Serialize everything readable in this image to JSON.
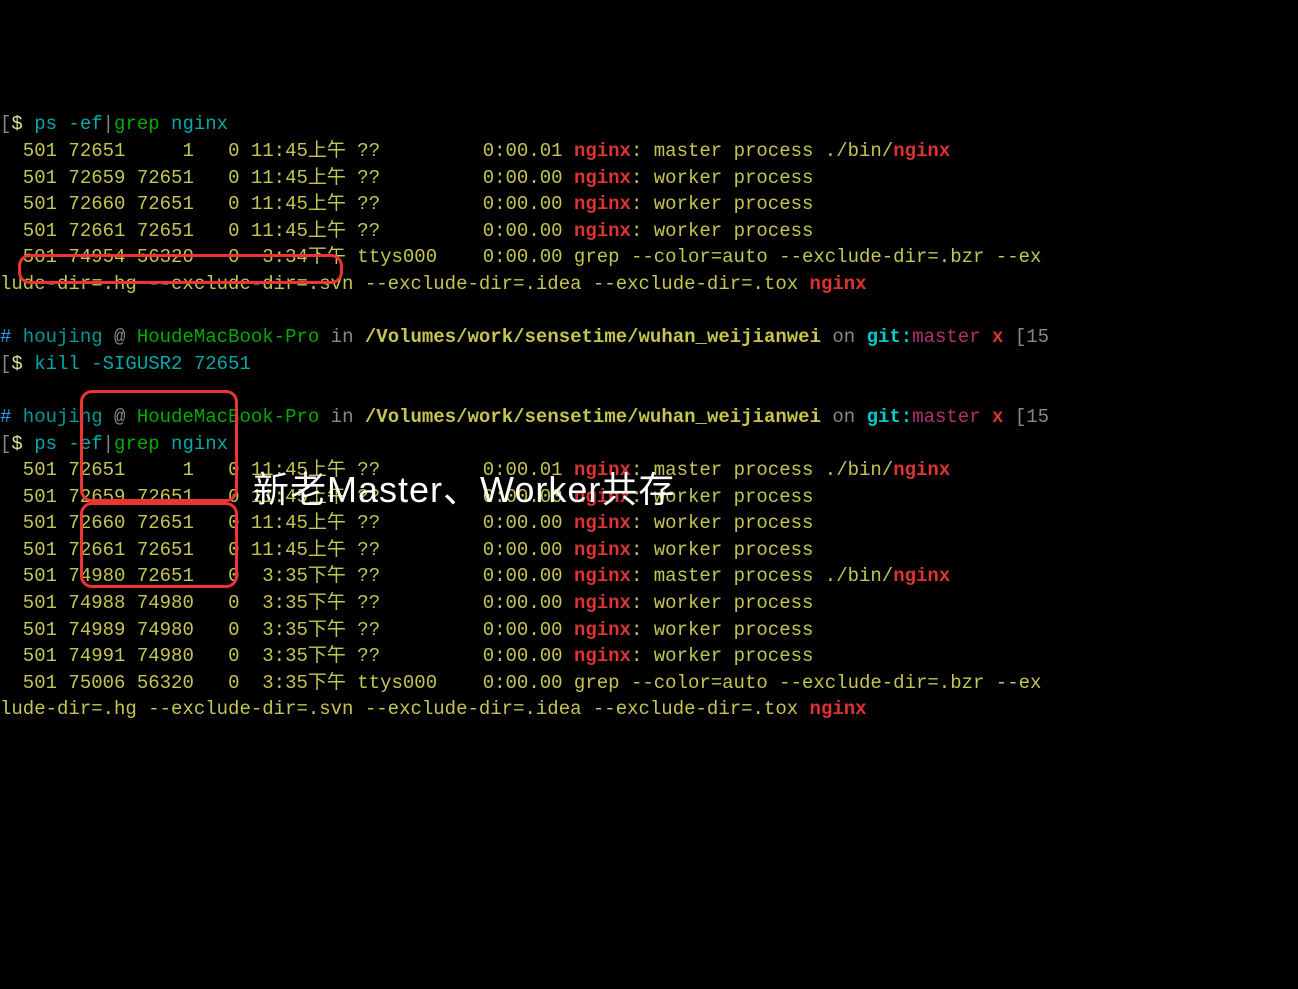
{
  "colors": {
    "bg": "#000000",
    "highlight": "#ee3333",
    "white": "#ffffff"
  },
  "overlay_text": "新老Master、Worker共存",
  "block1": {
    "prompt": {
      "bracket": "[",
      "dollar": "$",
      "cmd": " ps -ef",
      "pipe": "|",
      "grep": "grep",
      "arg": " nginx"
    },
    "rows": [
      {
        "uid": "  501",
        "pid": " 72651",
        "ppid": "     1",
        "c": "   0",
        "time": " 11:45上午",
        "tty": " ??",
        "elapsed": "         0:00.01 ",
        "proc": "nginx",
        "rest1": ": master process ./bin/",
        "rest2": "nginx"
      },
      {
        "uid": "  501",
        "pid": " 72659",
        "ppid": " 72651",
        "c": "   0",
        "time": " 11:45上午",
        "tty": " ??",
        "elapsed": "         0:00.00 ",
        "proc": "nginx",
        "rest1": ": worker process",
        "rest2": ""
      },
      {
        "uid": "  501",
        "pid": " 72660",
        "ppid": " 72651",
        "c": "   0",
        "time": " 11:45上午",
        "tty": " ??",
        "elapsed": "         0:00.00 ",
        "proc": "nginx",
        "rest1": ": worker process",
        "rest2": ""
      },
      {
        "uid": "  501",
        "pid": " 72661",
        "ppid": " 72651",
        "c": "   0",
        "time": " 11:45上午",
        "tty": " ??",
        "elapsed": "         0:00.00 ",
        "proc": "nginx",
        "rest1": ": worker process",
        "rest2": ""
      }
    ],
    "greprow": {
      "uid": "  501",
      "pid": " 74954",
      "ppid": " 56320",
      "c": "   0",
      "time": "  3:34下午",
      "tty": " ttys000",
      "elapsed": "    0:00.00 grep --color=auto --exclude-dir=.bzr --ex",
      "wrap": "lude-dir=.hg --exclude-dir=.svn --exclude-dir=.idea --exclude-dir=.tox ",
      "arg": "nginx"
    }
  },
  "ps1_1": {
    "hash": "#",
    "user": " houjing",
    "at": " @ ",
    "host": "HoudeMacBook-Pro",
    "in": " in ",
    "path": "/Volumes/work/sensetime/wuhan_weijianwei",
    "on": " on ",
    "git": "git:",
    "branch": "master",
    "x": " x",
    "time": " [15"
  },
  "kill": {
    "bracket": "[",
    "dollar": "$",
    "cmd": " kill -SIGUSR2 72651"
  },
  "ps1_2": {
    "hash": "#",
    "user": " houjing",
    "at": " @ ",
    "host": "HoudeMacBook-Pro",
    "in": " in ",
    "path": "/Volumes/work/sensetime/wuhan_weijianwei",
    "on": " on ",
    "git": "git:",
    "branch": "master",
    "x": " x",
    "time": " [15"
  },
  "block2": {
    "prompt": {
      "bracket": "[",
      "dollar": "$",
      "cmd": " ps -ef",
      "pipe": "|",
      "grep": "grep",
      "arg": " nginx"
    },
    "rows": [
      {
        "uid": "  501",
        "pid": " 72651",
        "ppid": "     1",
        "c": "   0",
        "time": " 11:45上午",
        "tty": " ??",
        "elapsed": "         0:00.01 ",
        "proc": "nginx",
        "rest1": ": master process ./bin/",
        "rest2": "nginx"
      },
      {
        "uid": "  501",
        "pid": " 72659",
        "ppid": " 72651",
        "c": "   0",
        "time": " 11:45上午",
        "tty": " ??",
        "elapsed": "         0:00.00 ",
        "proc": "nginx",
        "rest1": ": worker process",
        "rest2": ""
      },
      {
        "uid": "  501",
        "pid": " 72660",
        "ppid": " 72651",
        "c": "   0",
        "time": " 11:45上午",
        "tty": " ??",
        "elapsed": "         0:00.00 ",
        "proc": "nginx",
        "rest1": ": worker process",
        "rest2": ""
      },
      {
        "uid": "  501",
        "pid": " 72661",
        "ppid": " 72651",
        "c": "   0",
        "time": " 11:45上午",
        "tty": " ??",
        "elapsed": "         0:00.00 ",
        "proc": "nginx",
        "rest1": ": worker process",
        "rest2": ""
      },
      {
        "uid": "  501",
        "pid": " 74980",
        "ppid": " 72651",
        "c": "   0",
        "time": "  3:35下午",
        "tty": " ??",
        "elapsed": "         0:00.00 ",
        "proc": "nginx",
        "rest1": ": master process ./bin/",
        "rest2": "nginx"
      },
      {
        "uid": "  501",
        "pid": " 74988",
        "ppid": " 74980",
        "c": "   0",
        "time": "  3:35下午",
        "tty": " ??",
        "elapsed": "         0:00.00 ",
        "proc": "nginx",
        "rest1": ": worker process",
        "rest2": ""
      },
      {
        "uid": "  501",
        "pid": " 74989",
        "ppid": " 74980",
        "c": "   0",
        "time": "  3:35下午",
        "tty": " ??",
        "elapsed": "         0:00.00 ",
        "proc": "nginx",
        "rest1": ": worker process",
        "rest2": ""
      },
      {
        "uid": "  501",
        "pid": " 74991",
        "ppid": " 74980",
        "c": "   0",
        "time": "  3:35下午",
        "tty": " ??",
        "elapsed": "         0:00.00 ",
        "proc": "nginx",
        "rest1": ": worker process",
        "rest2": ""
      }
    ],
    "greprow": {
      "uid": "  501",
      "pid": " 75006",
      "ppid": " 56320",
      "c": "   0",
      "time": "  3:35下午",
      "tty": " ttys000",
      "elapsed": "    0:00.00 grep --color=auto --exclude-dir=.bzr --ex",
      "wrap": "lude-dir=.hg --exclude-dir=.svn --exclude-dir=.idea --exclude-dir=.tox ",
      "arg": "nginx"
    }
  }
}
